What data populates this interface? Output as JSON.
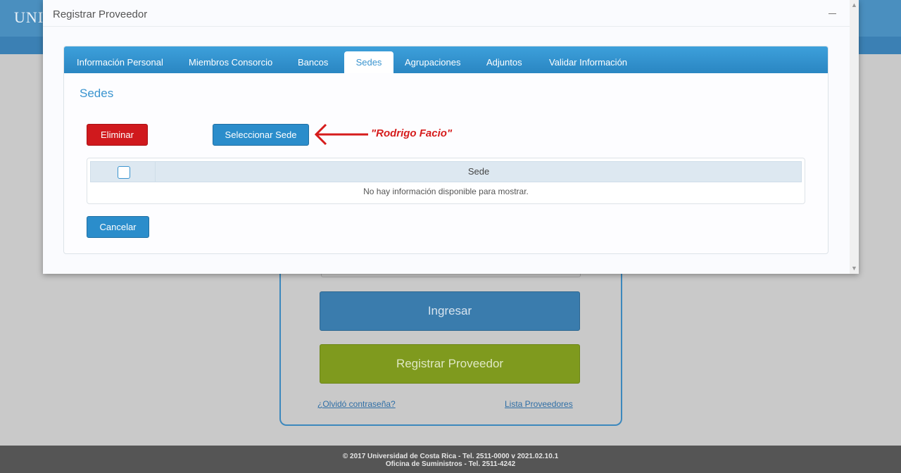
{
  "background": {
    "brand": "UNIV",
    "login": {
      "ingresar_label": "Ingresar",
      "registrar_label": "Registrar Proveedor",
      "forgot_link": "¿Olvidó contraseña?",
      "providers_link": "Lista Proveedores"
    },
    "footer": {
      "line1": "© 2017 Universidad de Costa Rica - Tel. 2511-0000 v 2021.02.10.1",
      "line2": "Oficina de Suministros - Tel. 2511-4242"
    }
  },
  "modal": {
    "title": "Registrar Proveedor",
    "tabs": [
      {
        "label": "Información Personal",
        "active": false
      },
      {
        "label": "Miembros Consorcio",
        "active": false
      },
      {
        "label": "Bancos",
        "active": false
      },
      {
        "label": "Sedes",
        "active": true
      },
      {
        "label": "Agrupaciones",
        "active": false
      },
      {
        "label": "Adjuntos",
        "active": false
      },
      {
        "label": "Validar Información",
        "active": false
      }
    ],
    "section_title": "Sedes",
    "buttons": {
      "delete_label": "Eliminar",
      "select_label": "Seleccionar Sede",
      "cancel_label": "Cancelar"
    },
    "annotation": "\"Rodrigo Facio\"",
    "grid": {
      "column_header": "Sede",
      "empty_message": "No hay información disponible para mostrar."
    }
  },
  "colors": {
    "tab_bar": "#2a86c2",
    "danger": "#d0191d",
    "primary": "#2b8dcb",
    "annotation": "#d61c1c",
    "success": "#7f9a1e"
  }
}
